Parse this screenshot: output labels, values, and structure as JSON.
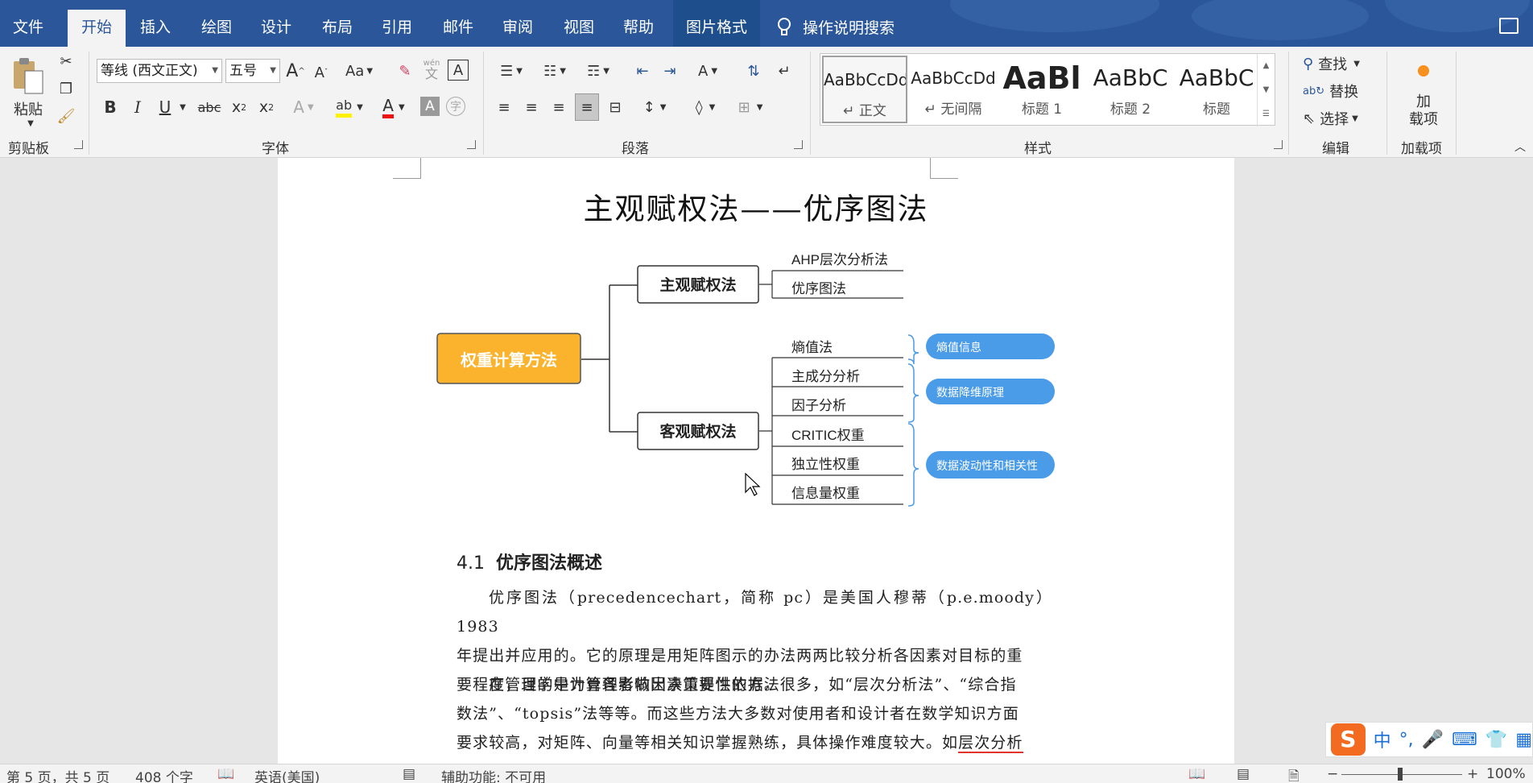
{
  "menu": {
    "tabs": [
      "文件",
      "开始",
      "插入",
      "绘图",
      "设计",
      "布局",
      "引用",
      "邮件",
      "审阅",
      "视图",
      "帮助",
      "图片格式"
    ],
    "active": "开始",
    "search_label": "操作说明搜索"
  },
  "clipboard": {
    "paste_label": "粘贴",
    "group_label": "剪贴板"
  },
  "font": {
    "font_name": "等线 (西文正文)",
    "font_size": "五号",
    "change_case_label": "Aa",
    "bold": "B",
    "italic": "I",
    "underline": "U",
    "strike": "abc",
    "phonetic": "wén",
    "phonetic_char": "文",
    "group_label": "字体"
  },
  "paragraph": {
    "group_label": "段落"
  },
  "styles": {
    "items": [
      {
        "preview": "AaBbCcDd",
        "name": "↵ 正文"
      },
      {
        "preview": "AaBbCcDd",
        "name": "↵ 无间隔"
      },
      {
        "preview": "AaBl",
        "name": "标题 1"
      },
      {
        "preview": "AaBbC",
        "name": "标题 2"
      },
      {
        "preview": "AaBbC",
        "name": "标题"
      }
    ],
    "group_label": "样式"
  },
  "editing": {
    "find": "查找",
    "replace": "替换",
    "select": "选择",
    "group_label": "编辑"
  },
  "addins": {
    "button_label": "加载项",
    "button_line1": "加",
    "button_line2": "载项",
    "group_label": "加载项"
  },
  "document": {
    "title": "主观赋权法——优序图法",
    "mindmap": {
      "root": "权重计算方法",
      "branches": [
        {
          "label": "主观赋权法",
          "leaves": [
            "AHP层次分析法",
            "优序图法"
          ]
        },
        {
          "label": "客观赋权法",
          "leaves": [
            "熵值法",
            "主成分分析",
            "因子分析",
            "CRITIC权重",
            "独立性权重",
            "信息量权重"
          ]
        }
      ],
      "tags": [
        "熵值信息",
        "数据降维原理",
        "数据波动性和相关性"
      ]
    },
    "section_number": "4.1",
    "section_title": "优序图法概述",
    "para1_line1": "优序图法（precedencechart，简称 pc）是美国人穆蒂（p.e.moody）1983",
    "para1_line2": "年提出并应用的。它的原理是用矩阵图示的办法两两比较分析各因素对目标的重",
    "para1_line3": "要程度，目的是为管理者做出决策提供依据。",
    "para2_line1": "在管理学中计算各影响因素重要性的方法很多，如“层次分析法”、“综合指",
    "para2_line2": "数法”、“topsis”法等等。而这些方法大多数对使用者和设计者在数学知识方面",
    "para2_line3a": "要求较高，对矩阵、向量等相关知识掌握熟练，具体操作难度较大。如",
    "para2_line3b": "层次分析"
  },
  "status": {
    "page": "第 5 页，共 5 页",
    "words": "408 个字",
    "language": "英语(美国)",
    "accessibility": "辅助功能: 不可用",
    "zoom": "100%"
  },
  "ime": {
    "lang": "中"
  },
  "colors": {
    "word_blue": "#2b579a",
    "root_fill": "#fbb22c",
    "tag_blue": "#4a9be8"
  }
}
